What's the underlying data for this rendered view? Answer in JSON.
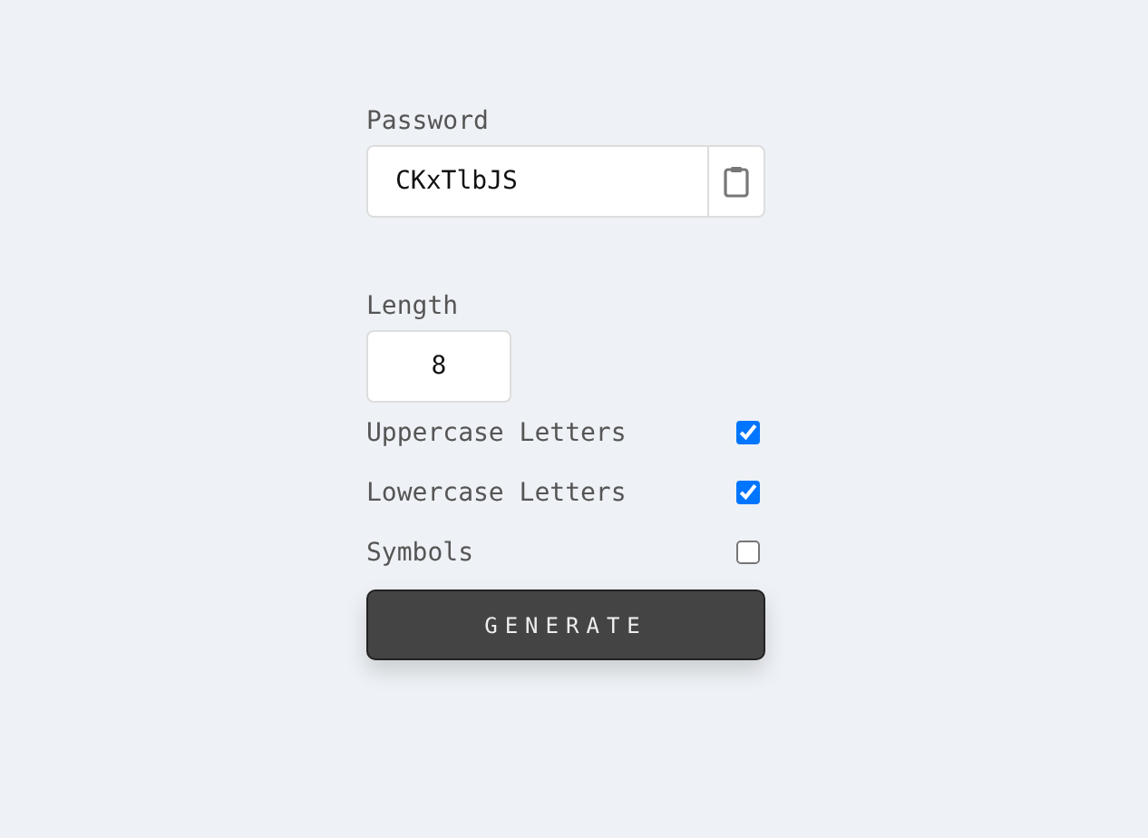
{
  "password": {
    "label": "Password",
    "value": "CKxTlbJS"
  },
  "length": {
    "label": "Length",
    "value": "8"
  },
  "options": [
    {
      "label": "Uppercase Letters",
      "checked": true
    },
    {
      "label": "Lowercase Letters",
      "checked": true
    },
    {
      "label": "Symbols",
      "checked": false
    }
  ],
  "button": "GENERATE"
}
